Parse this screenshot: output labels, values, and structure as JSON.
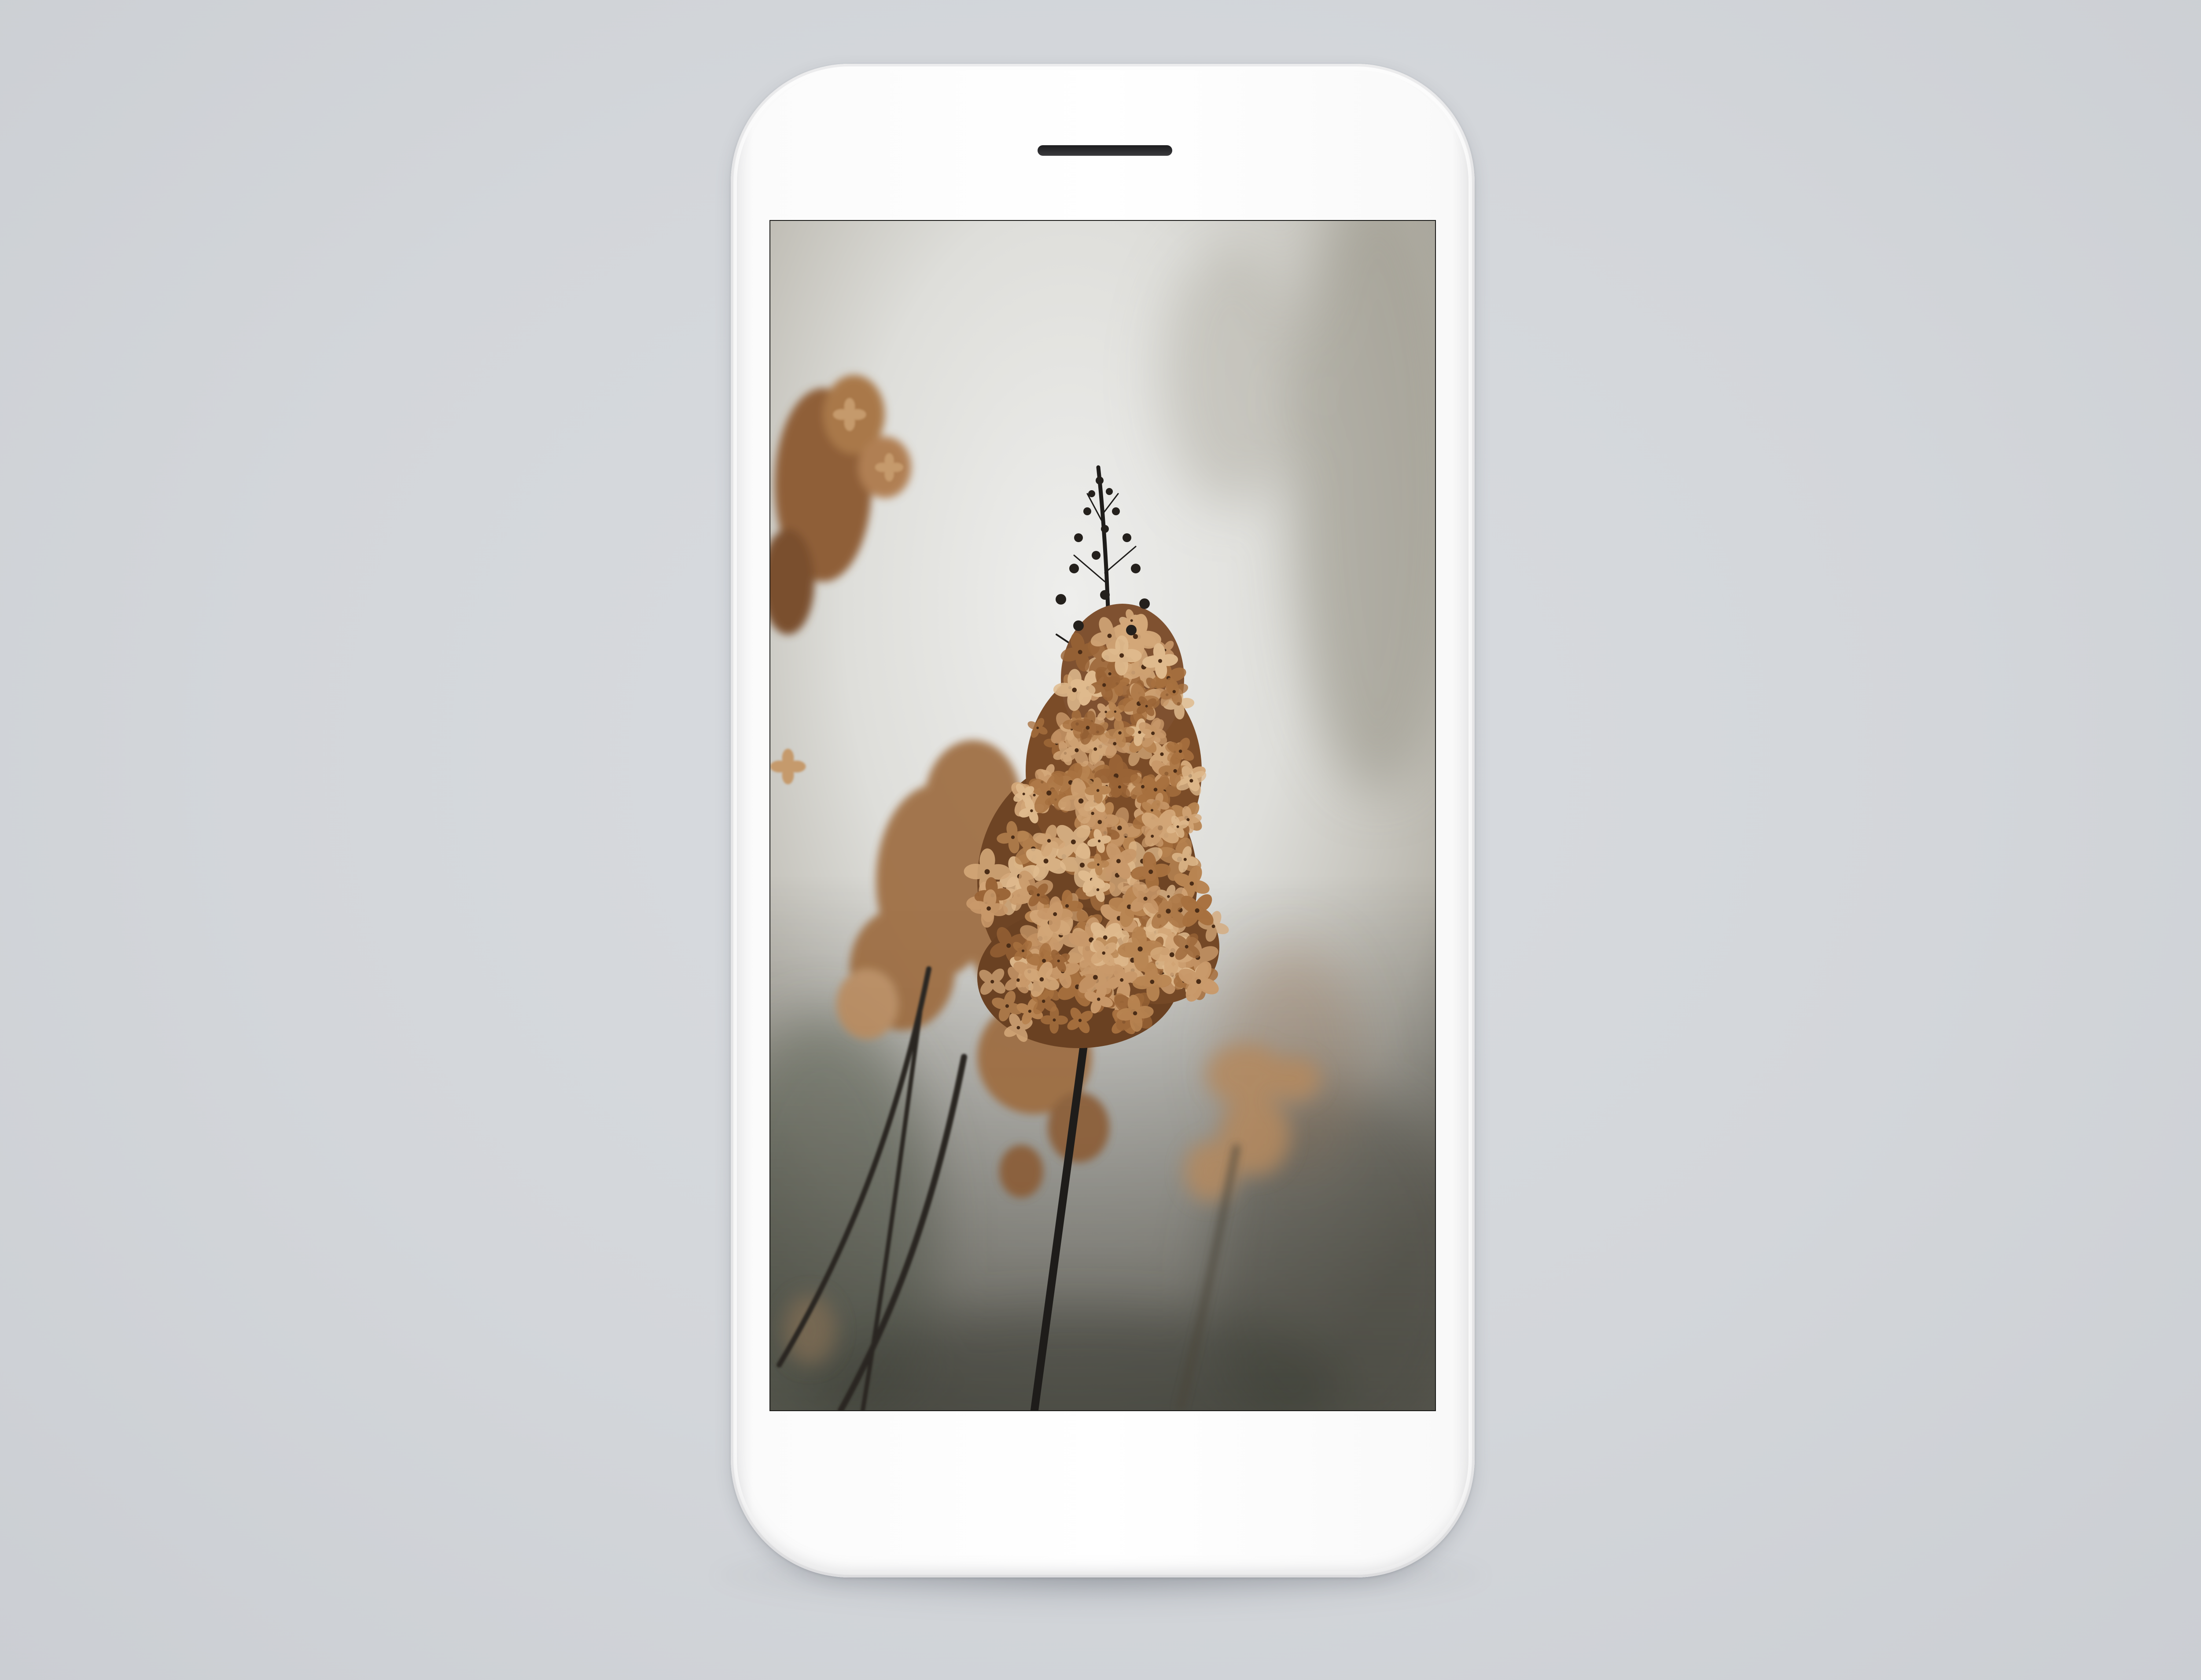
{
  "scene": {
    "background_color": "#d3d6da",
    "device": {
      "type": "smartphone",
      "body_color": "#ffffff",
      "speaker_icon": "speaker-grille"
    },
    "wallpaper": {
      "subject": "dried-hydrangea-flowers",
      "palette": [
        "#b9855a",
        "#7a4e2c",
        "#e6e6e2",
        "#2a2a28"
      ]
    }
  }
}
